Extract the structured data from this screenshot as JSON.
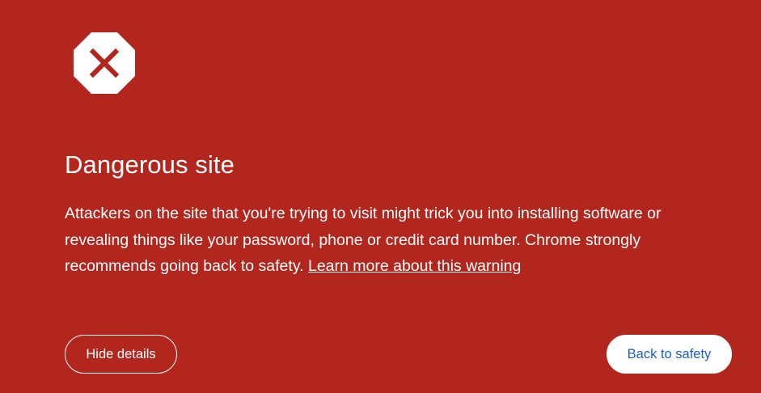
{
  "page": {
    "background_color": "#b3261e",
    "accent_link_color": "#1a5fc8"
  },
  "icon": {
    "name": "stop-sign-x-icon",
    "fill": "#ffffff",
    "mark_color": "#b3261e"
  },
  "heading": "Dangerous site",
  "body": {
    "text": "Attackers on the site that you're trying to visit might trick you into installing software or revealing things like your password, phone or credit card number. Chrome strongly recommends going back to safety. ",
    "learn_more_link": "Learn more about this warning"
  },
  "buttons": {
    "hide_details": "Hide details",
    "back_to_safety": "Back to safety"
  }
}
